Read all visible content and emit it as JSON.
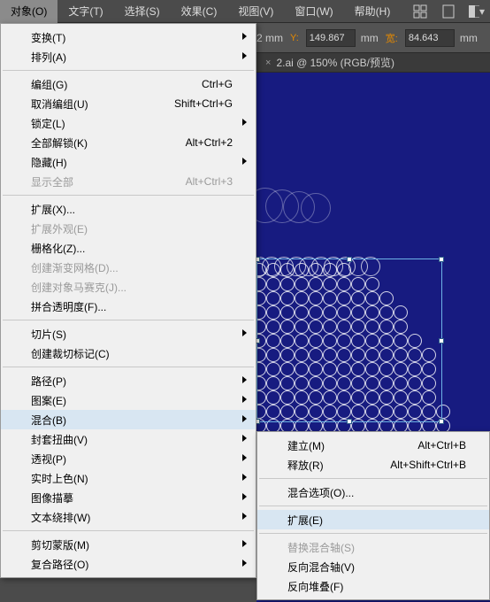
{
  "menubar": {
    "items": [
      "对象(O)",
      "文字(T)",
      "选择(S)",
      "效果(C)",
      "视图(V)",
      "窗口(W)",
      "帮助(H)"
    ]
  },
  "options_bar": {
    "unit_suffix": "2 mm",
    "y_label": "Y:",
    "y_value": "149.867",
    "w_label": "宽:",
    "w_value": "84.643",
    "mm": "mm"
  },
  "doc_tab": {
    "close": "×",
    "label": "2.ai @ 150% (RGB/预览)"
  },
  "dropdown": {
    "items": [
      {
        "label": "变换(T)",
        "sub": true
      },
      {
        "label": "排列(A)",
        "sub": true
      },
      {
        "sep": true
      },
      {
        "label": "编组(G)",
        "shortcut": "Ctrl+G"
      },
      {
        "label": "取消编组(U)",
        "shortcut": "Shift+Ctrl+G"
      },
      {
        "label": "锁定(L)",
        "sub": true
      },
      {
        "label": "全部解锁(K)",
        "shortcut": "Alt+Ctrl+2"
      },
      {
        "label": "隐藏(H)",
        "sub": true
      },
      {
        "label": "显示全部",
        "shortcut": "Alt+Ctrl+3",
        "disabled": true
      },
      {
        "sep": true
      },
      {
        "label": "扩展(X)..."
      },
      {
        "label": "扩展外观(E)",
        "disabled": true
      },
      {
        "label": "栅格化(Z)..."
      },
      {
        "label": "创建渐变网格(D)...",
        "disabled": true
      },
      {
        "label": "创建对象马赛克(J)...",
        "disabled": true
      },
      {
        "label": "拼合透明度(F)..."
      },
      {
        "sep": true
      },
      {
        "label": "切片(S)",
        "sub": true
      },
      {
        "label": "创建裁切标记(C)"
      },
      {
        "sep": true
      },
      {
        "label": "路径(P)",
        "sub": true
      },
      {
        "label": "图案(E)",
        "sub": true
      },
      {
        "label": "混合(B)",
        "sub": true,
        "hl": true
      },
      {
        "label": "封套扭曲(V)",
        "sub": true
      },
      {
        "label": "透视(P)",
        "sub": true
      },
      {
        "label": "实时上色(N)",
        "sub": true
      },
      {
        "label": "图像描摹",
        "sub": true
      },
      {
        "label": "文本绕排(W)",
        "sub": true
      },
      {
        "sep": true
      },
      {
        "label": "剪切蒙版(M)",
        "sub": true
      },
      {
        "label": "复合路径(O)",
        "sub": true
      }
    ]
  },
  "submenu": {
    "items": [
      {
        "label": "建立(M)",
        "shortcut": "Alt+Ctrl+B"
      },
      {
        "label": "释放(R)",
        "shortcut": "Alt+Shift+Ctrl+B"
      },
      {
        "sep": true
      },
      {
        "label": "混合选项(O)..."
      },
      {
        "sep": true
      },
      {
        "label": "扩展(E)",
        "hl": true
      },
      {
        "sep": true
      },
      {
        "label": "替换混合轴(S)",
        "disabled": true
      },
      {
        "label": "反向混合轴(V)"
      },
      {
        "label": "反向堆叠(F)"
      }
    ]
  }
}
